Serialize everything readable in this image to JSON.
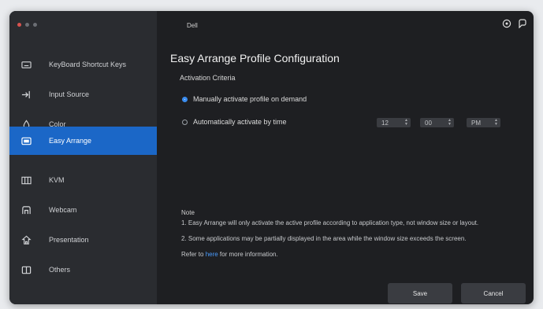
{
  "app": {
    "title": "Dell"
  },
  "sidebar": {
    "items": [
      {
        "label": "KeyBoard Shortcut Keys",
        "icon": "keyboard-icon",
        "active": false
      },
      {
        "label": "Input Source",
        "icon": "input-source-icon",
        "active": false
      },
      {
        "label": "Color",
        "icon": "color-icon",
        "active": false
      },
      {
        "label": "Easy Arrange",
        "icon": "easy-arrange-icon",
        "active": true
      },
      {
        "label": "KVM",
        "icon": "kvm-icon",
        "active": false
      },
      {
        "label": "Webcam",
        "icon": "webcam-icon",
        "active": false
      },
      {
        "label": "Presentation",
        "icon": "presentation-icon",
        "active": false
      },
      {
        "label": "Others",
        "icon": "others-icon",
        "active": false
      }
    ]
  },
  "main": {
    "title": "Easy Arrange Profile Configuration",
    "section_label": "Activation Criteria",
    "options": [
      {
        "label": "Manually activate profile on demand",
        "checked": true
      },
      {
        "label": "Automatically activate by time",
        "checked": false
      }
    ],
    "time": {
      "hour": "12",
      "minute": "00",
      "period": "PM"
    },
    "note": {
      "title": "Note",
      "lines": [
        "1. Easy Arrange will only activate the active profile according to application type, not window size or layout.",
        "2. Some applications may be partially displayed in the area while the window size exceeds the screen."
      ],
      "more_prefix": "Refer to ",
      "more_link": "here",
      "more_suffix": " for more information."
    },
    "buttons": {
      "save": "Save",
      "cancel": "Cancel"
    }
  },
  "colors": {
    "accent": "#1b67c7",
    "background": "#1e1f22",
    "sidebar": "#2a2c30"
  }
}
